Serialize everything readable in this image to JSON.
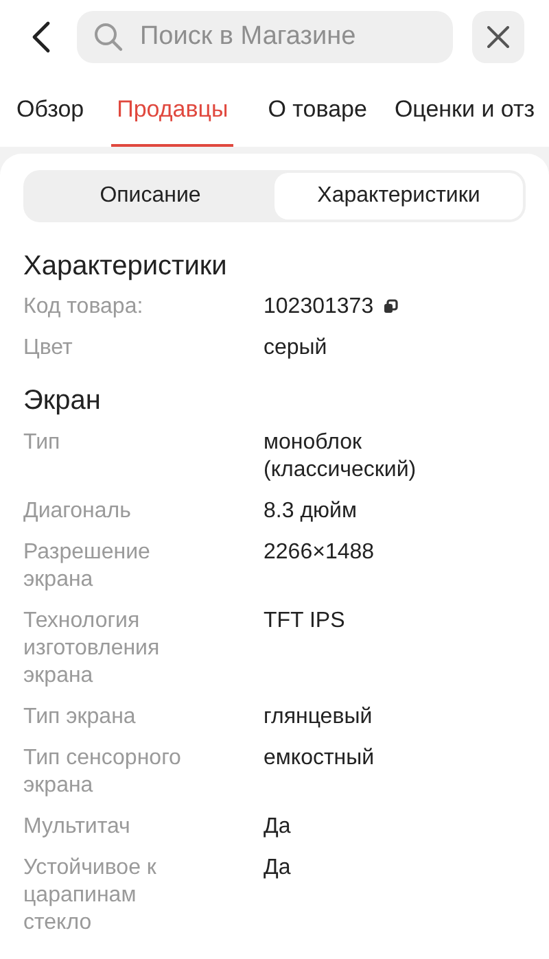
{
  "search": {
    "placeholder": "Поиск в Магазине"
  },
  "tabs": [
    {
      "label": "Обзор",
      "selected": false
    },
    {
      "label": "Продавцы",
      "selected": true
    },
    {
      "label": "О товаре",
      "selected": false
    },
    {
      "label": "Оценки и отз",
      "selected": false
    }
  ],
  "segments": [
    {
      "label": "Описание",
      "selected": false
    },
    {
      "label": "Характеристики",
      "selected": true
    }
  ],
  "sections": [
    {
      "heading": "Характеристики",
      "rows": [
        {
          "label": "Код товара:",
          "value": "102301373",
          "copyable": true
        },
        {
          "label": "Цвет",
          "value": "серый"
        }
      ]
    },
    {
      "heading": "Экран",
      "rows": [
        {
          "label": "Тип",
          "value": "моноблок (классический)"
        },
        {
          "label": "Диагональ",
          "value": "8.3 дюйм"
        },
        {
          "label": "Разрешение экрана",
          "value": "2266×1488"
        },
        {
          "label": "Технология изготовления экрана",
          "value": "TFT IPS"
        },
        {
          "label": "Тип экрана",
          "value": "глянцевый"
        },
        {
          "label": "Тип сенсорного экрана",
          "value": "емкостный"
        },
        {
          "label": "Мультитач",
          "value": "Да"
        },
        {
          "label": "Устойчивое к царапинам стекло",
          "value": "Да"
        }
      ]
    }
  ]
}
